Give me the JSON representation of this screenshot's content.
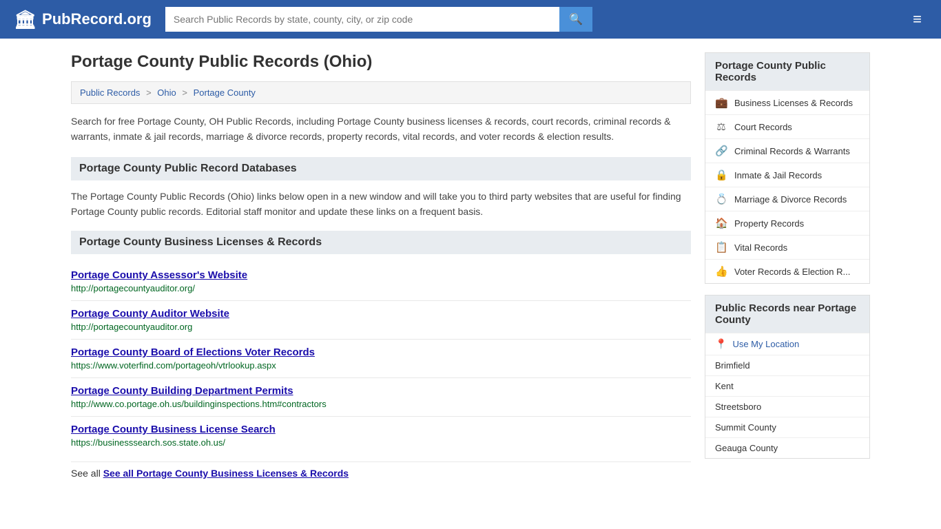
{
  "header": {
    "logo_text": "PubRecord.org",
    "logo_icon": "🏛",
    "search_placeholder": "Search Public Records by state, county, city, or zip code",
    "search_icon": "🔍",
    "hamburger_icon": "≡"
  },
  "page": {
    "title": "Portage County Public Records (Ohio)",
    "breadcrumbs": [
      {
        "label": "Public Records",
        "href": "#"
      },
      {
        "label": "Ohio",
        "href": "#"
      },
      {
        "label": "Portage County",
        "href": "#"
      }
    ],
    "description": "Search for free Portage County, OH Public Records, including Portage County business licenses & records, court records, criminal records & warrants, inmate & jail records, marriage & divorce records, property records, vital records, and voter records & election results.",
    "databases_header": "Portage County Public Record Databases",
    "databases_description": "The Portage County Public Records (Ohio) links below open in a new window and will take you to third party websites that are useful for finding Portage County public records. Editorial staff monitor and update these links on a frequent basis.",
    "business_section_header": "Portage County Business Licenses & Records",
    "records": [
      {
        "title": "Portage County Assessor's Website",
        "url": "http://portagecountyauditor.org/"
      },
      {
        "title": "Portage County Auditor Website",
        "url": "http://portagecountyauditor.org"
      },
      {
        "title": "Portage County Board of Elections Voter Records",
        "url": "https://www.voterfind.com/portageoh/vtrlookup.aspx"
      },
      {
        "title": "Portage County Building Department Permits",
        "url": "http://www.co.portage.oh.us/buildinginspections.htm#contractors"
      },
      {
        "title": "Portage County Business License Search",
        "url": "https://businesssearch.sos.state.oh.us/"
      }
    ],
    "see_all_label": "See all Portage County Business Licenses & Records"
  },
  "sidebar": {
    "box1_header": "Portage County Public Records",
    "categories": [
      {
        "label": "Business Licenses & Records",
        "icon": "💼"
      },
      {
        "label": "Court Records",
        "icon": "⚖"
      },
      {
        "label": "Criminal Records & Warrants",
        "icon": "🔗"
      },
      {
        "label": "Inmate & Jail Records",
        "icon": "🔒"
      },
      {
        "label": "Marriage & Divorce Records",
        "icon": "💍"
      },
      {
        "label": "Property Records",
        "icon": "🏠"
      },
      {
        "label": "Vital Records",
        "icon": "📋"
      },
      {
        "label": "Voter Records & Election R...",
        "icon": "👍"
      }
    ],
    "box2_header": "Public Records near Portage County",
    "use_location_label": "Use My Location",
    "nearby": [
      "Brimfield",
      "Kent",
      "Streetsboro",
      "Summit County",
      "Geauga County"
    ]
  }
}
